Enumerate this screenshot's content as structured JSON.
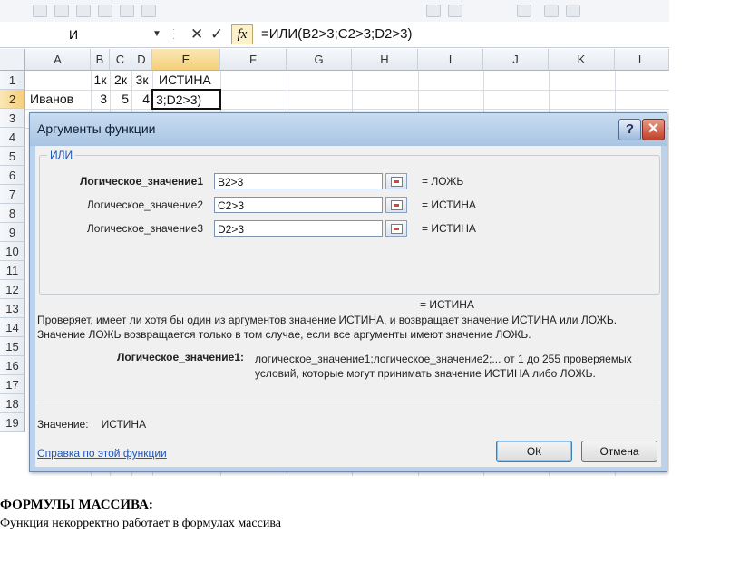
{
  "formula_bar": {
    "name_box": "И",
    "cancel_icon": "✕",
    "enter_icon": "✓",
    "fx_label": "fx",
    "formula": "=ИЛИ(B2>3;C2>3;D2>3)"
  },
  "sheet": {
    "columns": [
      "A",
      "B",
      "C",
      "D",
      "E",
      "F",
      "G",
      "H",
      "I",
      "J",
      "K",
      "L"
    ],
    "rows": [
      "1",
      "2",
      "3",
      "4",
      "5",
      "6",
      "7",
      "8",
      "9",
      "10",
      "11",
      "12",
      "13",
      "14",
      "15",
      "16",
      "17",
      "18",
      "19"
    ],
    "row1": {
      "B": "1к",
      "C": "2к",
      "D": "3к",
      "E": "ИСТИНА"
    },
    "row2": {
      "A": "Иванов",
      "B": "3",
      "C": "5",
      "D": "4",
      "E": "3;D2>3)"
    }
  },
  "dialog": {
    "title": "Аргументы функции",
    "help_icon": "?",
    "close_icon": "✕",
    "function_name": "ИЛИ",
    "arguments": [
      {
        "label": "Логическое_значение1",
        "value": "B2>3",
        "result": "=  ЛОЖЬ"
      },
      {
        "label": "Логическое_значение2",
        "value": "C2>3",
        "result": "=  ИСТИНА"
      },
      {
        "label": "Логическое_значение3",
        "value": "D2>3",
        "result": "=  ИСТИНА"
      }
    ],
    "total_result": "=  ИСТИНА",
    "description_line1": "Проверяет, имеет ли хотя бы один из аргументов значение ИСТИНА, и возвращает значение ИСТИНА или ЛОЖЬ.",
    "description_line2": "Значение ЛОЖЬ возвращается только в том случае, если все аргументы имеют значение ЛОЖЬ.",
    "arg_help_label": "Логическое_значение1:",
    "arg_help_text": "логическое_значение1;логическое_значение2;... от 1 до 255 проверяемых условий, которые могут принимать значение ИСТИНА либо ЛОЖЬ.",
    "value_label": "Значение:",
    "value": "ИСТИНА",
    "help_link": "Справка по этой функции",
    "ok_label": "ОК",
    "cancel_label": "Отмена"
  },
  "caption": {
    "title": "ФОРМУЛЫ МАССИВА:",
    "text": "Функция некорректно работает в формулах массива"
  }
}
